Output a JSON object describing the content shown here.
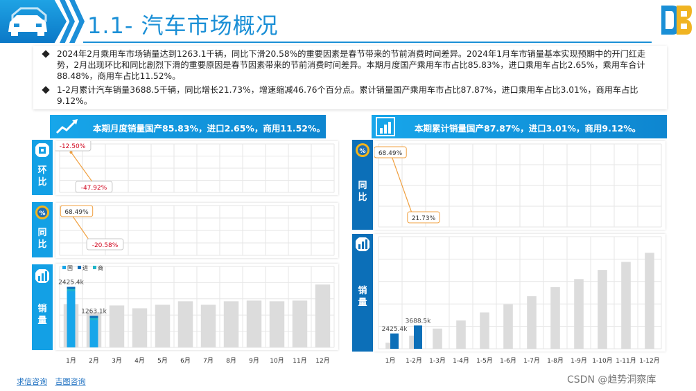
{
  "header": {
    "title": "1.1- 汽车市场概况"
  },
  "bullets": [
    "2024年2月乘用车市场销量达到1263.1千辆，同比下滑20.58%的重要因素是春节带来的节前消费时间差异。2024年1月车市销量基本实现预期中的开门红走势，2月出现环比和同比剧烈下滑的重要原因是春节因素带来的节前消费时间差异。本期月度国产乘用车市占比85.83%，进口乘用车占比2.65%，乘用车合计88.48%，商用车占比11.52%。",
    "1-2月累计汽车销量3688.5千辆，同比增长21.73%，增速缩减46.76个百分点。累计销量国产乘用车市占比87.87%，进口乘用车占比3.01%，商用车占比9.12%。"
  ],
  "left_banner": {
    "text": "本期月度销量国产85.83%，进口2.65%，商用11.52%。"
  },
  "right_banner": {
    "text": "本期累计销量国产87.87%，进口3.01%，商用9.12%。"
  },
  "tabs": {
    "mom": "环比",
    "yoy": "同比",
    "sales": "销量",
    "cum_yoy": "同比",
    "cum_sales": "销量"
  },
  "legend": [
    "国",
    "进",
    "商"
  ],
  "colors": {
    "domestic": "#17a6ea",
    "import": "#0c6fb8",
    "commercial": "#1fb6c9",
    "placeholder": "#dcdcdc",
    "positive_border": "#f0a040",
    "negative_border": "#c8c8c8",
    "negative_text": "#d0021b"
  },
  "footer": {
    "link1": "求信咨询",
    "link2": "吉图咨询"
  },
  "watermark": "CSDN @趋势洞察库",
  "chart_data": [
    {
      "type": "line",
      "name": "monthly-mom",
      "categories": [
        "1月",
        "2月",
        "3月",
        "4月",
        "5月",
        "6月",
        "7月",
        "8月",
        "9月",
        "10月",
        "11月",
        "12月"
      ],
      "values": [
        -12.5,
        -47.92,
        null,
        null,
        null,
        null,
        null,
        null,
        null,
        null,
        null,
        null
      ],
      "labels": [
        "-12.50%",
        "-47.92%"
      ],
      "grid": true
    },
    {
      "type": "line",
      "name": "monthly-yoy",
      "categories": [
        "1月",
        "2月",
        "3月",
        "4月",
        "5月",
        "6月",
        "7月",
        "8月",
        "9月",
        "10月",
        "11月",
        "12月"
      ],
      "values": [
        68.49,
        -20.58,
        null,
        null,
        null,
        null,
        null,
        null,
        null,
        null,
        null,
        null
      ],
      "labels": [
        "68.49%",
        "-20.58%"
      ],
      "grid": true
    },
    {
      "type": "bar",
      "name": "monthly-sales",
      "categories": [
        "1月",
        "2月",
        "3月",
        "4月",
        "5月",
        "6月",
        "7月",
        "8月",
        "9月",
        "10月",
        "11月",
        "12月"
      ],
      "totals": [
        2425.4,
        1263.1,
        null,
        null,
        null,
        null,
        null,
        null,
        null,
        null,
        null,
        null
      ],
      "total_labels": [
        "2425.4k",
        "1263.1k"
      ],
      "placeholder_levels": [
        0.62,
        0.5,
        0.6,
        0.56,
        0.61,
        0.66,
        0.61,
        0.66,
        0.67,
        0.66,
        0.67,
        0.9
      ],
      "legend": [
        "国",
        "进",
        "商"
      ]
    },
    {
      "type": "line",
      "name": "cumulative-yoy",
      "categories": [
        "1月",
        "1-2月",
        "1-3月",
        "1-4月",
        "1-5月",
        "1-6月",
        "1-7月",
        "1-8月",
        "1-9月",
        "1-10月",
        "1-11月",
        "1-12月"
      ],
      "values": [
        68.49,
        21.73,
        null,
        null,
        null,
        null,
        null,
        null,
        null,
        null,
        null,
        null
      ],
      "labels": [
        "68.49%",
        "21.73%"
      ],
      "grid": true
    },
    {
      "type": "bar",
      "name": "cumulative-sales",
      "categories": [
        "1月",
        "1-2月",
        "1-3月",
        "1-4月",
        "1-5月",
        "1-6月",
        "1-7月",
        "1-8月",
        "1-9月",
        "1-10月",
        "1-11月",
        "1-12月"
      ],
      "totals": [
        2425.4,
        3688.5,
        null,
        null,
        null,
        null,
        null,
        null,
        null,
        null,
        null,
        null
      ],
      "total_labels": [
        "2425.4k",
        "3688.5k"
      ],
      "placeholder_levels": [
        0.06,
        0.13,
        0.2,
        0.28,
        0.36,
        0.44,
        0.52,
        0.61,
        0.69,
        0.78,
        0.86,
        0.95
      ]
    }
  ]
}
